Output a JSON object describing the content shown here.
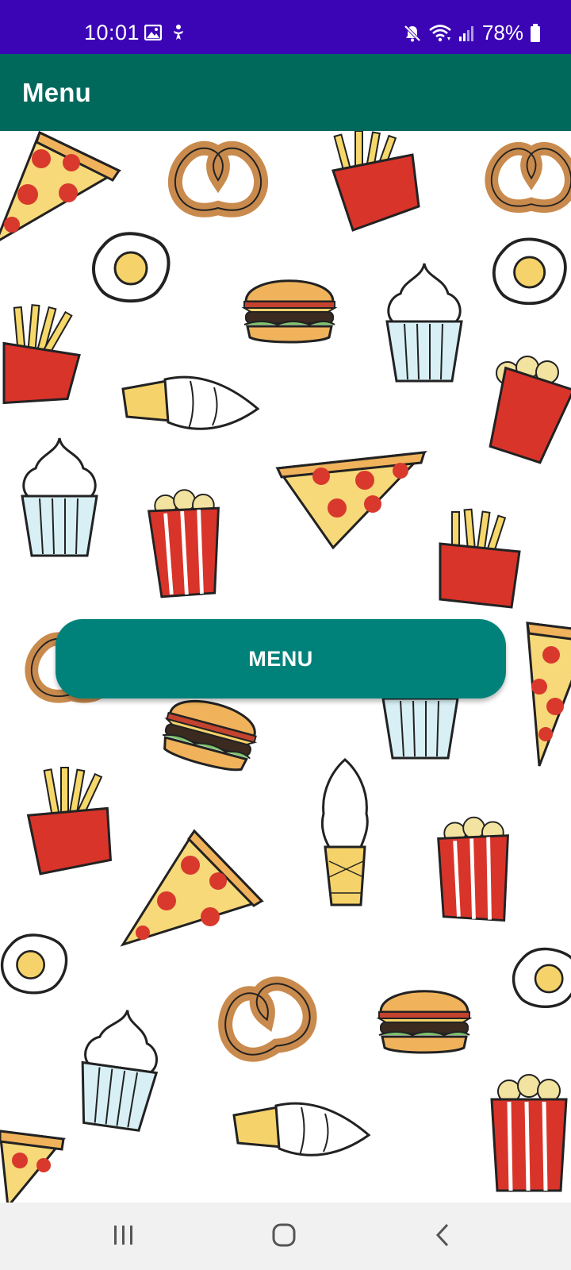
{
  "status_bar": {
    "time": "10:01",
    "battery_percent": "78%",
    "left_icons": [
      "image-notification-icon",
      "accessibility-notification-icon"
    ],
    "right_icons": [
      "mute-icon",
      "wifi-icon",
      "signal-icon",
      "battery-icon"
    ]
  },
  "app_bar": {
    "title": "Menu"
  },
  "main": {
    "menu_button_label": "MENU"
  },
  "background_pattern": {
    "items": [
      "pizza-slice",
      "pretzel",
      "french-fries",
      "fried-egg",
      "burger",
      "cupcake",
      "ice-cream-cone",
      "popcorn"
    ]
  },
  "nav_bar": {
    "buttons": [
      "recent-apps",
      "home",
      "back"
    ]
  },
  "colors": {
    "status_bar": "#3b05b5",
    "app_bar": "#00695c",
    "button": "#00827a",
    "nav_bar": "#f1f1f1"
  }
}
